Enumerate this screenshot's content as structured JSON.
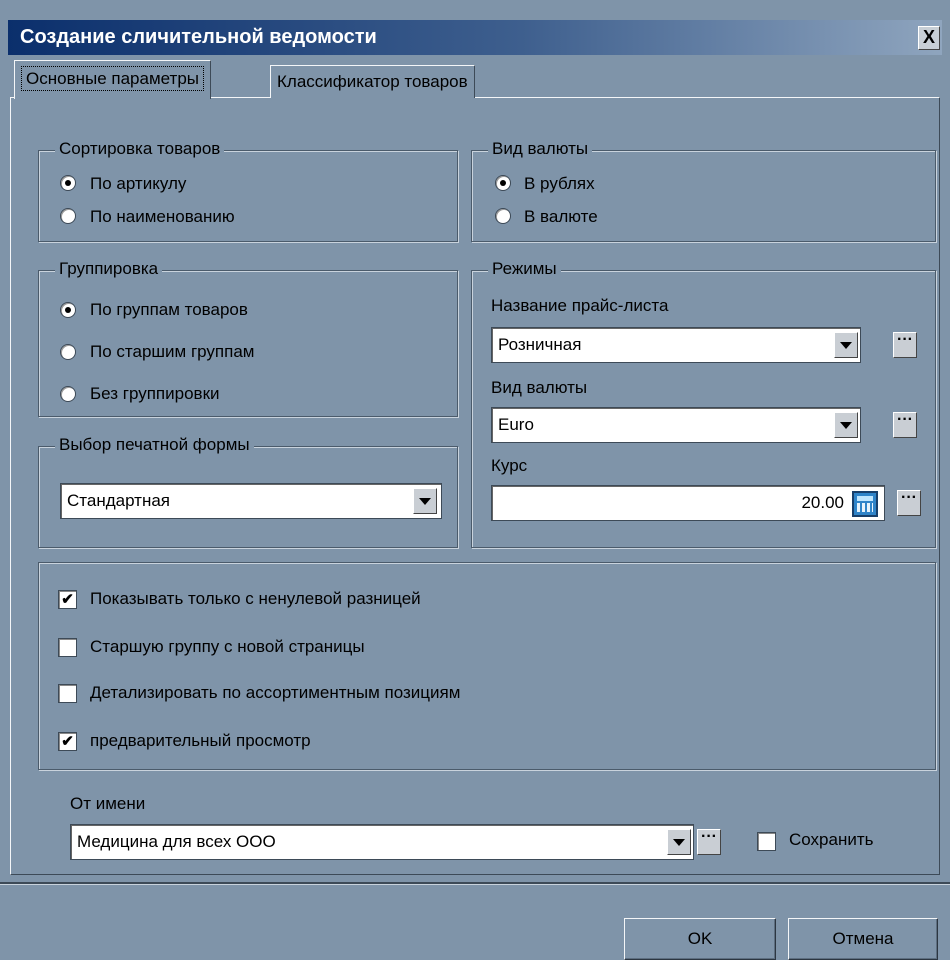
{
  "window": {
    "title": "Создание сличительной ведомости",
    "close_symbol": "X"
  },
  "tabs": [
    {
      "label": "Основные параметры",
      "active": true
    },
    {
      "label": "Классификатор товаров",
      "active": false
    }
  ],
  "sorting": {
    "legend": "Сортировка товаров",
    "options": [
      "По артикулу",
      "По наименованию"
    ],
    "selected": 0
  },
  "currency_kind": {
    "legend": "Вид валюты",
    "options": [
      "В рублях",
      "В валюте"
    ],
    "selected": 0
  },
  "grouping": {
    "legend": "Группировка",
    "options": [
      "По группам товаров",
      "По старшим группам",
      "Без группировки"
    ],
    "selected": 0
  },
  "print_form": {
    "legend": "Выбор печатной формы",
    "value": "Стандартная"
  },
  "modes": {
    "legend": "Режимы",
    "price_list_label": "Название прайс-листа",
    "price_list_value": "Розничная",
    "currency_label": "Вид валюты",
    "currency_value": "Euro",
    "rate_label": "Курс",
    "rate_value": "20.00"
  },
  "options": [
    {
      "label": "Показывать только с ненулевой разницей",
      "checked": true
    },
    {
      "label": "Старшую группу с новой страницы",
      "checked": false
    },
    {
      "label": "Детализировать по ассортиментным позициям",
      "checked": false
    },
    {
      "label": "предварительный просмотр",
      "checked": true
    }
  ],
  "on_behalf": {
    "label": "От имени",
    "value": "Медицина для всех ООО",
    "save_label": "Сохранить",
    "save_checked": false
  },
  "buttons": {
    "ok": "OK",
    "cancel": "Отмена"
  },
  "ellipsis": "···",
  "check_mark": "✔",
  "colors": {
    "background": "#7f94a9",
    "title_bar": "#0b2f6c"
  }
}
